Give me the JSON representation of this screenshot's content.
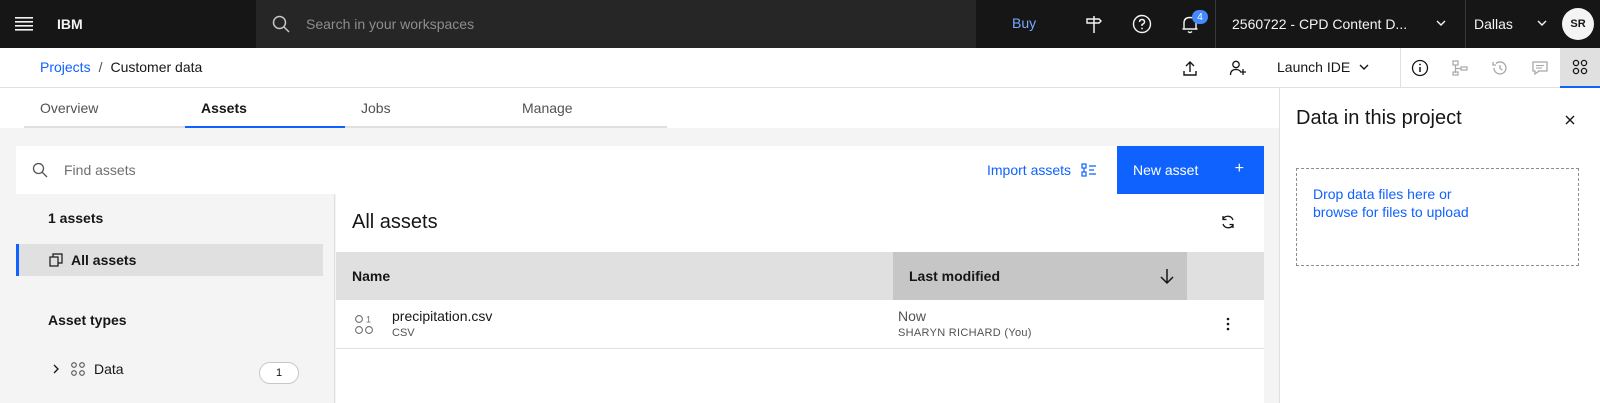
{
  "header": {
    "brand": "IBM",
    "search_placeholder": "Search in your workspaces",
    "buy_label": "Buy",
    "notification_count": "4",
    "account_label": "2560722 - CPD Content D...",
    "region_label": "Dallas",
    "avatar_initials": "SR"
  },
  "breadcrumb": {
    "root": "Projects",
    "separator": "/",
    "current": "Customer data"
  },
  "toolbar_top": {
    "launch_ide_label": "Launch IDE"
  },
  "tabs": [
    {
      "label": "Overview"
    },
    {
      "label": "Assets"
    },
    {
      "label": "Jobs"
    },
    {
      "label": "Manage"
    }
  ],
  "assets_toolbar": {
    "search_placeholder": "Find assets",
    "import_label": "Import assets",
    "new_asset_label": "New asset",
    "new_asset_plus": "+"
  },
  "left_panel": {
    "count_label": "1 assets",
    "all_assets_label": "All assets",
    "asset_types_heading": "Asset types",
    "data_label": "Data",
    "data_count": "1"
  },
  "main": {
    "title": "All assets",
    "columns": [
      "Name",
      "Last modified"
    ],
    "rows": [
      {
        "name": "precipitation.csv",
        "type": "CSV",
        "modified": "Now",
        "modified_by": "SHARYN RICHARD (You)"
      }
    ]
  },
  "side_panel": {
    "title": "Data in this project",
    "drop_line1": "Drop data files here or",
    "drop_line2": "browse for files to upload"
  },
  "colors": {
    "accent": "#0f62fe",
    "header_bg": "#161616",
    "link_dark": "#78a9ff"
  }
}
